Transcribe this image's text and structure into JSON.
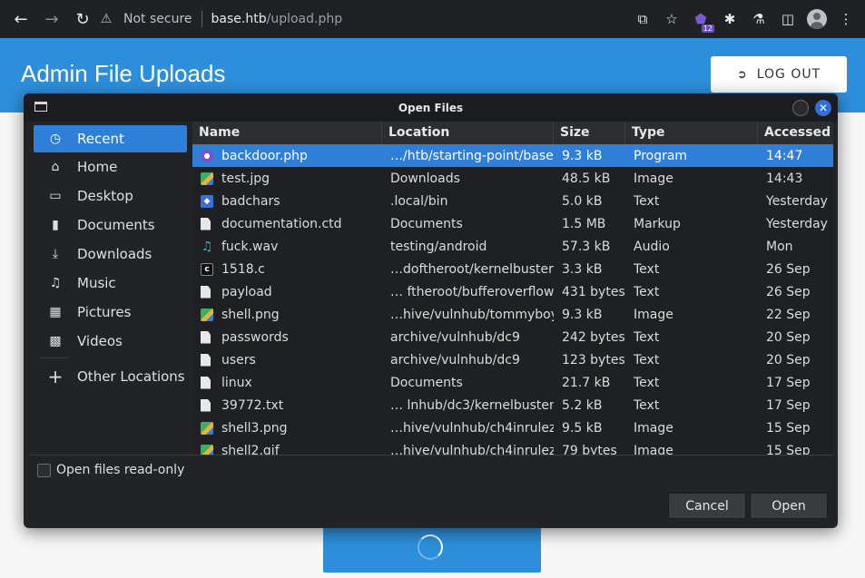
{
  "browser": {
    "security_label": "Not secure",
    "url_host": "base.htb",
    "url_path": "/upload.php",
    "extension_badge": "12"
  },
  "page": {
    "title": "Admin File Uploads",
    "logout_label": "LOG OUT"
  },
  "dialog": {
    "title": "Open Files",
    "sidebar": [
      {
        "label": "Recent",
        "icon": "clock-icon"
      },
      {
        "label": "Home",
        "icon": "home-icon"
      },
      {
        "label": "Desktop",
        "icon": "desktop-icon"
      },
      {
        "label": "Documents",
        "icon": "document-icon"
      },
      {
        "label": "Downloads",
        "icon": "download-icon"
      },
      {
        "label": "Music",
        "icon": "music-icon"
      },
      {
        "label": "Pictures",
        "icon": "picture-icon"
      },
      {
        "label": "Videos",
        "icon": "video-icon"
      }
    ],
    "other_locations": "Other Locations",
    "columns": {
      "name": "Name",
      "location": "Location",
      "size": "Size",
      "type": "Type",
      "accessed": "Accessed"
    },
    "files": [
      {
        "name": "backdoor.php",
        "location": "…/htb/starting-point/base",
        "size": "9.3 kB",
        "type": "Program",
        "accessed": "14:47",
        "icon": "php"
      },
      {
        "name": "test.jpg",
        "location": "Downloads",
        "size": "48.5 kB",
        "type": "Image",
        "accessed": "14:43",
        "icon": "img"
      },
      {
        "name": "badchars",
        "location": ".local/bin",
        "size": "5.0 kB",
        "type": "Text",
        "accessed": "Yesterday",
        "icon": "exec"
      },
      {
        "name": "documentation.ctd",
        "location": "Documents",
        "size": "1.5 MB",
        "type": "Markup",
        "accessed": "Yesterday",
        "icon": "doc"
      },
      {
        "name": "fuck.wav",
        "location": "testing/android",
        "size": "57.3 kB",
        "type": "Audio",
        "accessed": "Mon",
        "icon": "audio"
      },
      {
        "name": "1518.c",
        "location": "…doftheroot/kernelbuster",
        "size": "3.3 kB",
        "type": "Text",
        "accessed": "26 Sep",
        "icon": "c"
      },
      {
        "name": "payload",
        "location": "… ftheroot/bufferoverflow",
        "size": "431 bytes",
        "type": "Text",
        "accessed": "26 Sep",
        "icon": "doc"
      },
      {
        "name": "shell.png",
        "location": "…hive/vulnhub/tommyboy",
        "size": "9.3 kB",
        "type": "Image",
        "accessed": "22 Sep",
        "icon": "img"
      },
      {
        "name": "passwords",
        "location": "archive/vulnhub/dc9",
        "size": "242 bytes",
        "type": "Text",
        "accessed": "20 Sep",
        "icon": "doc"
      },
      {
        "name": "users",
        "location": "archive/vulnhub/dc9",
        "size": "123 bytes",
        "type": "Text",
        "accessed": "20 Sep",
        "icon": "doc"
      },
      {
        "name": "linux",
        "location": "Documents",
        "size": "21.7 kB",
        "type": "Text",
        "accessed": "17 Sep",
        "icon": "doc"
      },
      {
        "name": "39772.txt",
        "location": "… lnhub/dc3/kernelbuster",
        "size": "5.2 kB",
        "type": "Text",
        "accessed": "17 Sep",
        "icon": "doc"
      },
      {
        "name": "shell3.png",
        "location": "…hive/vulnhub/ch4inrulez",
        "size": "9.5 kB",
        "type": "Image",
        "accessed": "15 Sep",
        "icon": "img"
      },
      {
        "name": "shell2.gif",
        "location": "…hive/vulnhub/ch4inrulez",
        "size": "79 bytes",
        "type": "Image",
        "accessed": "15 Sep",
        "icon": "img"
      }
    ],
    "readonly_label": "Open files read-only",
    "cancel_label": "Cancel",
    "open_label": "Open"
  }
}
